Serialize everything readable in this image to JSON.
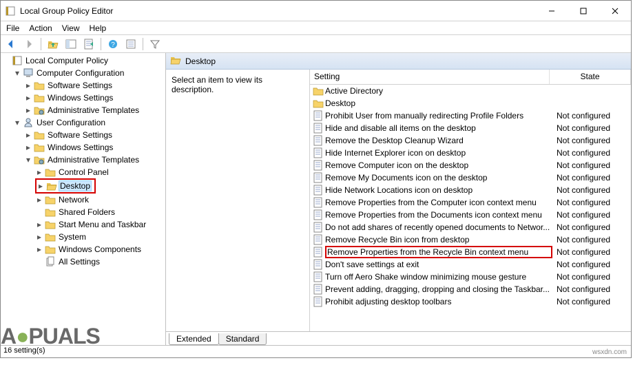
{
  "window": {
    "title": "Local Group Policy Editor"
  },
  "menubar": {
    "file": "File",
    "action": "Action",
    "view": "View",
    "help": "Help"
  },
  "tree": {
    "root": "Local Computer Policy",
    "cc": "Computer Configuration",
    "cc_soft": "Software Settings",
    "cc_win": "Windows Settings",
    "cc_adm": "Administrative Templates",
    "uc": "User Configuration",
    "uc_soft": "Software Settings",
    "uc_win": "Windows Settings",
    "uc_adm": "Administrative Templates",
    "cp": "Control Panel",
    "desktop": "Desktop",
    "network": "Network",
    "shared": "Shared Folders",
    "startmenu": "Start Menu and Taskbar",
    "system": "System",
    "wincomp": "Windows Components",
    "allset": "All Settings"
  },
  "pathbar": {
    "label": "Desktop"
  },
  "description": {
    "prompt": "Select an item to view its description."
  },
  "columns": {
    "setting": "Setting",
    "state": "State"
  },
  "state_nc": "Not configured",
  "folders": {
    "ad": "Active Directory",
    "desktop": "Desktop"
  },
  "settings": [
    "Prohibit User from manually redirecting Profile Folders",
    "Hide and disable all items on the desktop",
    "Remove the Desktop Cleanup Wizard",
    "Hide Internet Explorer icon on desktop",
    "Remove Computer icon on the desktop",
    "Remove My Documents icon on the desktop",
    "Hide Network Locations icon on desktop",
    "Remove Properties from the Computer icon context menu",
    "Remove Properties from the Documents icon context menu",
    "Do not add shares of recently opened documents to Networ...",
    "Remove Recycle Bin icon from desktop",
    "Remove Properties from the Recycle Bin context menu",
    "Don't save settings at exit",
    "Turn off Aero Shake window minimizing mouse gesture",
    "Prevent adding, dragging, dropping and closing the Taskbar...",
    "Prohibit adjusting desktop toolbars"
  ],
  "highlighted_index": 11,
  "tabs": {
    "extended": "Extended",
    "standard": "Standard"
  },
  "status": {
    "text": "16 setting(s)"
  },
  "watermark": "wsxdn.com"
}
